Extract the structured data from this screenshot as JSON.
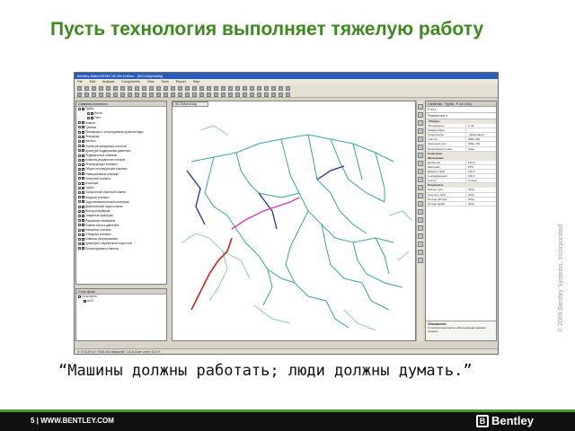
{
  "slide": {
    "title": "Пусть технология выполняет тяжелую работу",
    "quote": "“Машины должны работать; люди должны думать.”",
    "copyright": "© 2009 Bentley Systems, Incorporated",
    "footer_text": "5 | WWW.BENTLEY.COM",
    "logo_text": "Bentley",
    "colors": {
      "title": "#3c8a1e",
      "footer_bg": "#111111",
      "footer_accent": "#4a9b2a"
    }
  },
  "app": {
    "window_title": "Bentley WaterGEMS V8 XM Edition - [WCOMprkdelq]",
    "menu": [
      "File",
      "Edit",
      "Analysis",
      "Components",
      "View",
      "Tools",
      "Report",
      "Help"
    ],
    "element_panel": {
      "title": "Символы элемента",
      "items": [
        "Трубы",
        "Насос",
        "Узел",
        "Клапан",
        "Тройник",
        "Резервуары с регулируемым уровнем воды",
        "Резервуар",
        "Насосы",
        "Группа регулирующих насосов",
        "Арматура поддержания давления",
        "Редукционные клапаны",
        "Клапаны управления потоком",
        "Регулирующие клапаны",
        "Общие регулирующие клапаны",
        "Универсальные клапаны",
        "Запорные клапаны",
        "Изоляция",
        "Трубы",
        "Поворотный обратный клапан",
        "Входные клапаны",
        "Гидропневматический резервуар",
        "Двигательный подач-клапан",
        "Выход резервуара",
        "Защитные арматуры",
        "Разрывные мембраны",
        "Клапан сброса давления",
        "Напорные клапаны",
        "Отводные клапаны",
        "Клапаны регулирования",
        "Арматура с переменной скоростью",
        "Проектируемые клапаны"
      ]
    },
    "background_panel": {
      "title": "Слои фона",
      "items": [
        "Слои фона",
        "wCO"
      ]
    },
    "map_tab": "WCOMprkd.wtg",
    "properties_panel": {
      "title": "Свойства - Труба - P-44 (152)",
      "selector_value": "P-44",
      "filter_value": "Показать все",
      "rows": [
        {
          "k": "Обозначение",
          "v": "P-44"
        },
        {
          "k": "Комментарии",
          "v": ""
        },
        {
          "k": "Гиперссылки",
          "v": "<Неактивен>"
        },
        {
          "k": "Участок",
          "v": "SDE-J-80"
        },
        {
          "k": "Конечный узел",
          "v": "SDE-J-69"
        },
        {
          "k": "Изменяемая длина",
          "v": "Ложь"
        },
        {
          "k": "Длина (м)",
          "v": "152,8"
        },
        {
          "k": "Материал",
          "v": "PVC"
        },
        {
          "k": "Диаметр (мм)",
          "v": "150,0"
        },
        {
          "k": "C-коэффициент",
          "v": "130,0"
        },
        {
          "k": "Статус",
          "v": "Открыт"
        },
        {
          "k": "Расход (л/с)",
          "v": "(N/A)"
        },
        {
          "k": "Скорость (м/с)",
          "v": "(N/A)"
        },
        {
          "k": "Потери напора",
          "v": "(N/A)"
        },
        {
          "k": "Потери (м/км)",
          "v": "(N/A)"
        }
      ],
      "sections": [
        "<Общие>",
        "Геометрия",
        "Физические",
        "Результаты"
      ],
      "note_title": "Обозначение",
      "note_text": "Отличительная метка, обозначающая данный элемент."
    },
    "status": "X: 1710,57 м  Y: 9183,40 м  Масштаб: 1:11 м  Zoom Level: 42,3 %"
  }
}
